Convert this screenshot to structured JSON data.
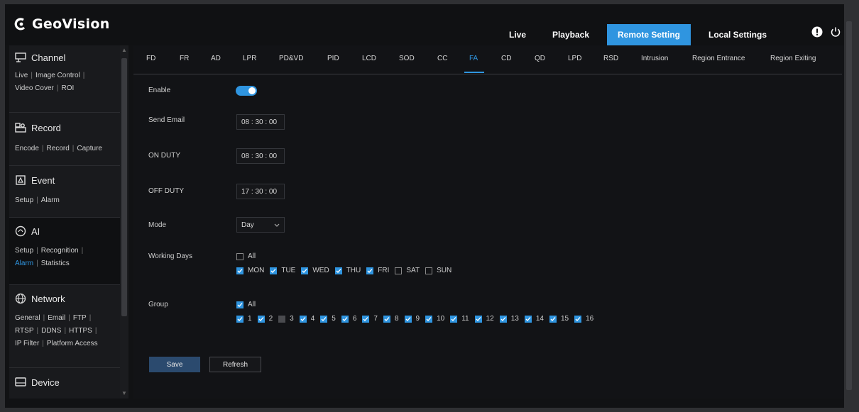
{
  "brand": {
    "name": "GeoVision"
  },
  "nav": [
    {
      "label": "Live",
      "active": false
    },
    {
      "label": "Playback",
      "active": false
    },
    {
      "label": "Remote Setting",
      "active": true
    },
    {
      "label": "Local Settings",
      "active": false
    }
  ],
  "sidebar": {
    "sections": [
      {
        "title": "Channel",
        "links": [
          "Live",
          "Image Control",
          "Video Cover",
          "ROI"
        ]
      },
      {
        "title": "Record",
        "links": [
          "Encode",
          "Record",
          "Capture"
        ]
      },
      {
        "title": "Event",
        "links": [
          "Setup",
          "Alarm"
        ]
      },
      {
        "title": "AI",
        "links": [
          "Setup",
          "Recognition",
          "Alarm",
          "Statistics"
        ],
        "active_link": "Alarm"
      },
      {
        "title": "Network",
        "links": [
          "General",
          "Email",
          "FTP",
          "RTSP",
          "DDNS",
          "HTTPS",
          "IP Filter",
          "Platform Access"
        ]
      },
      {
        "title": "Device",
        "links": []
      }
    ]
  },
  "tabs": [
    "FD",
    "FR",
    "AD",
    "LPR",
    "PD&VD",
    "PID",
    "LCD",
    "SOD",
    "CC",
    "FA",
    "CD",
    "QD",
    "LPD",
    "RSD",
    "Intrusion",
    "Region Entrance",
    "Region Exiting"
  ],
  "active_tab": "FA",
  "form": {
    "enable_label": "Enable",
    "enable_value": true,
    "send_email_label": "Send Email",
    "send_email_value": "08 : 30 : 00",
    "on_duty_label": "ON DUTY",
    "on_duty_value": "08 : 30 : 00",
    "off_duty_label": "OFF DUTY",
    "off_duty_value": "17 : 30 : 00",
    "mode_label": "Mode",
    "mode_value": "Day",
    "working_days_label": "Working Days",
    "all_label": "All",
    "working_days_all": false,
    "days": [
      {
        "label": "MON",
        "checked": true
      },
      {
        "label": "TUE",
        "checked": true
      },
      {
        "label": "WED",
        "checked": true
      },
      {
        "label": "THU",
        "checked": true
      },
      {
        "label": "FRI",
        "checked": true
      },
      {
        "label": "SAT",
        "checked": false
      },
      {
        "label": "SUN",
        "checked": false
      }
    ],
    "group_label": "Group",
    "group_all": true,
    "groups": [
      {
        "label": "1",
        "state": "on"
      },
      {
        "label": "2",
        "state": "on"
      },
      {
        "label": "3",
        "state": "disabled"
      },
      {
        "label": "4",
        "state": "on"
      },
      {
        "label": "5",
        "state": "on"
      },
      {
        "label": "6",
        "state": "on"
      },
      {
        "label": "7",
        "state": "on"
      },
      {
        "label": "8",
        "state": "on"
      },
      {
        "label": "9",
        "state": "on"
      },
      {
        "label": "10",
        "state": "on"
      },
      {
        "label": "11",
        "state": "on"
      },
      {
        "label": "12",
        "state": "on"
      },
      {
        "label": "13",
        "state": "on"
      },
      {
        "label": "14",
        "state": "on"
      },
      {
        "label": "15",
        "state": "on"
      },
      {
        "label": "16",
        "state": "on"
      }
    ]
  },
  "buttons": {
    "save": "Save",
    "refresh": "Refresh"
  },
  "colors": {
    "accent": "#2f95e0",
    "save_bg": "#2b4a6e"
  }
}
